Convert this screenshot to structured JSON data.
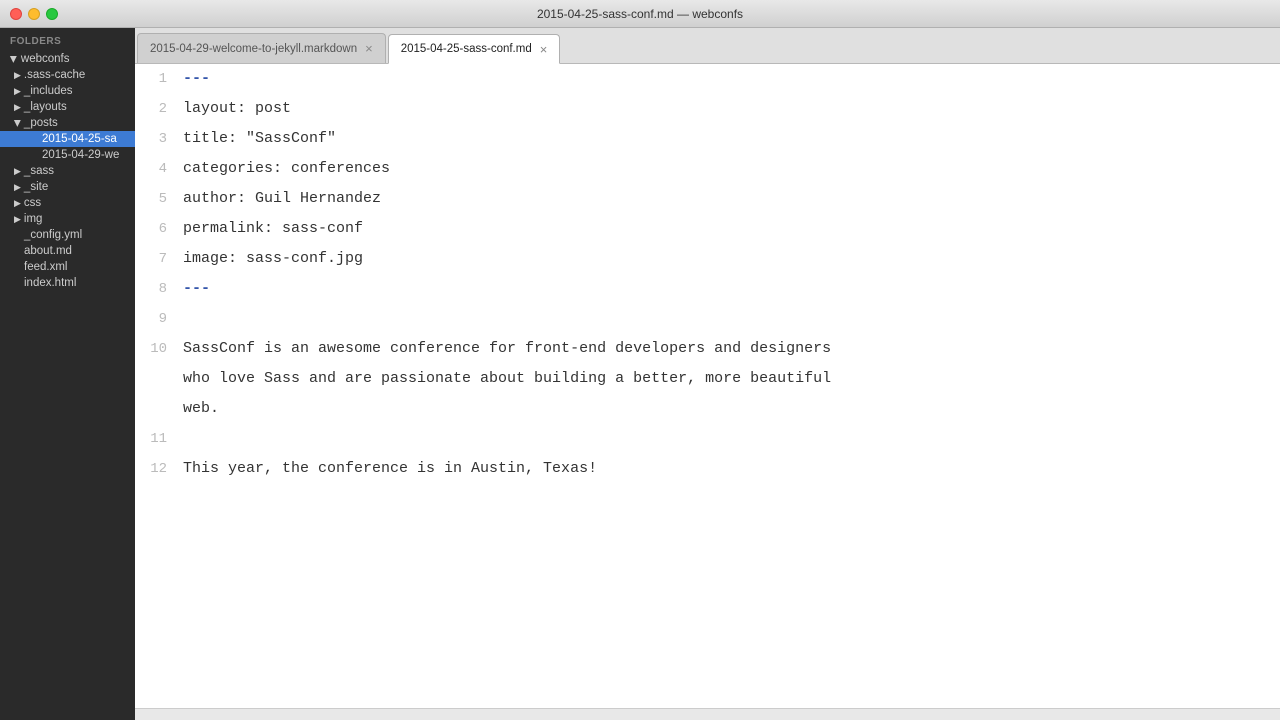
{
  "titlebar": {
    "title": "2015-04-25-sass-conf.md — webconfs"
  },
  "window_controls": {
    "close_label": "",
    "min_label": "",
    "max_label": ""
  },
  "sidebar": {
    "header": "FOLDERS",
    "root": "webconfs",
    "items": [
      {
        "id": "sass-cache",
        "label": ".sass-cache",
        "level": 1,
        "arrow": true,
        "open": false
      },
      {
        "id": "includes",
        "label": "_includes",
        "level": 1,
        "arrow": true,
        "open": false
      },
      {
        "id": "layouts",
        "label": "_layouts",
        "level": 1,
        "arrow": true,
        "open": false
      },
      {
        "id": "posts",
        "label": "_posts",
        "level": 1,
        "arrow": true,
        "open": true
      },
      {
        "id": "post1",
        "label": "2015-04-25-sa",
        "level": 2,
        "arrow": false,
        "selected": true
      },
      {
        "id": "post2",
        "label": "2015-04-29-we",
        "level": 2,
        "arrow": false,
        "selected": false
      },
      {
        "id": "sass",
        "label": "_sass",
        "level": 1,
        "arrow": true,
        "open": false
      },
      {
        "id": "site",
        "label": "_site",
        "level": 1,
        "arrow": true,
        "open": false
      },
      {
        "id": "css",
        "label": "css",
        "level": 1,
        "arrow": true,
        "open": false
      },
      {
        "id": "img",
        "label": "img",
        "level": 1,
        "arrow": true,
        "open": false
      },
      {
        "id": "config",
        "label": "_config.yml",
        "level": 0,
        "arrow": false
      },
      {
        "id": "about",
        "label": "about.md",
        "level": 0,
        "arrow": false
      },
      {
        "id": "feed",
        "label": "feed.xml",
        "level": 0,
        "arrow": false
      },
      {
        "id": "index",
        "label": "index.html",
        "level": 0,
        "arrow": false
      }
    ]
  },
  "tabs": [
    {
      "id": "tab1",
      "label": "2015-04-29-welcome-to-jekyll.markdown",
      "active": false
    },
    {
      "id": "tab2",
      "label": "2015-04-25-sass-conf.md",
      "active": true
    }
  ],
  "editor": {
    "lines": [
      {
        "num": 1,
        "content": "---",
        "style": "dashes"
      },
      {
        "num": 2,
        "content": "layout: post",
        "style": ""
      },
      {
        "num": 3,
        "content": "title: \"SassConf\"",
        "style": ""
      },
      {
        "num": 4,
        "content": "categories: conferences",
        "style": ""
      },
      {
        "num": 5,
        "content": "author: Guil Hernandez",
        "style": ""
      },
      {
        "num": 6,
        "content": "permalink: sass-conf",
        "style": ""
      },
      {
        "num": 7,
        "content": "image: sass-conf.jpg",
        "style": ""
      },
      {
        "num": 8,
        "content": "---",
        "style": "dashes"
      },
      {
        "num": 9,
        "content": "",
        "style": ""
      },
      {
        "num": 10,
        "content": "SassConf is an awesome conference for front-end developers and designers\nwho love Sass and are passionate about building a better, more beautiful\nweb.",
        "style": "multiline"
      },
      {
        "num": 11,
        "content": "",
        "style": ""
      },
      {
        "num": 12,
        "content": "This year, the conference is in Austin, Texas!",
        "style": ""
      }
    ]
  }
}
